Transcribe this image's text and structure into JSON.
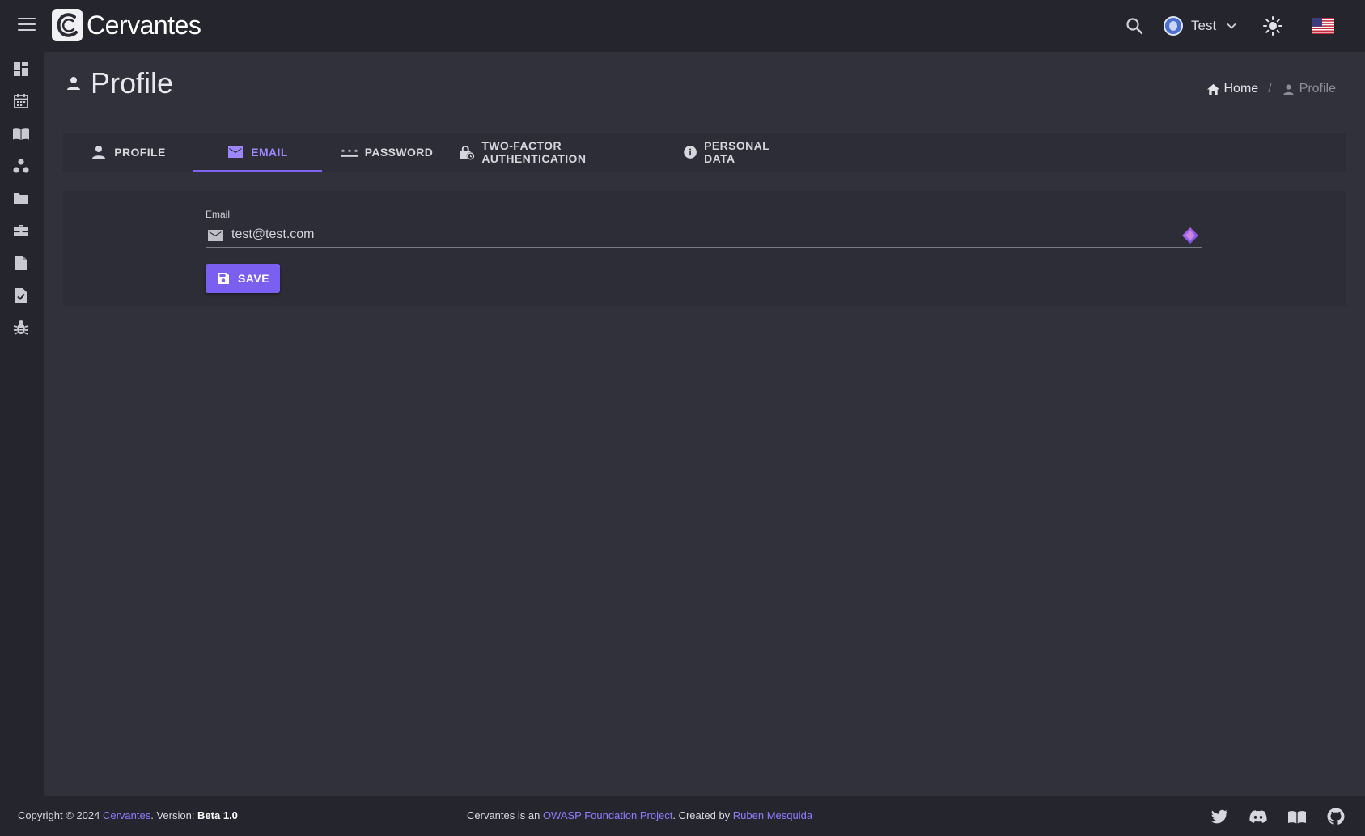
{
  "app": {
    "name": "Cervantes"
  },
  "header": {
    "user_name": "Test",
    "language": "en-US"
  },
  "sidebar": {
    "items": [
      {
        "icon": "dashboard-icon"
      },
      {
        "icon": "calendar-icon"
      },
      {
        "icon": "book-icon"
      },
      {
        "icon": "clients-icon"
      },
      {
        "icon": "folder-icon"
      },
      {
        "icon": "briefcase-icon"
      },
      {
        "icon": "document-icon"
      },
      {
        "icon": "checklist-icon"
      },
      {
        "icon": "bug-icon"
      }
    ]
  },
  "page": {
    "title": "Profile"
  },
  "breadcrumb": {
    "home": "Home",
    "current": "Profile"
  },
  "tabs": [
    {
      "label": "PROFILE",
      "icon": "person-icon",
      "active": false
    },
    {
      "label": "EMAIL",
      "icon": "mail-icon",
      "active": true
    },
    {
      "label": "PASSWORD",
      "icon": "password-icon",
      "active": false
    },
    {
      "label": "TWO-FACTOR AUTHENTICATION",
      "icon": "lock-clock-icon",
      "active": false
    },
    {
      "label": "PERSONAL DATA",
      "icon": "info-icon",
      "active": false
    }
  ],
  "email_form": {
    "label": "Email",
    "value": "test@test.com",
    "save_label": "SAVE"
  },
  "footer": {
    "copyright_prefix": "Copyright © 2024 ",
    "brand_link": "Cervantes",
    "version_prefix": ". Version: ",
    "version": "Beta 1.0",
    "center_prefix": "Cervantes is an ",
    "owasp_link": "OWASP Foundation Project",
    "created_by": ". Created by ",
    "author_link": "Ruben Mesquida"
  },
  "colors": {
    "accent": "#7b5ff0",
    "accent_text": "#9d86ff",
    "background": "#30313a",
    "bars": "#25262d"
  }
}
